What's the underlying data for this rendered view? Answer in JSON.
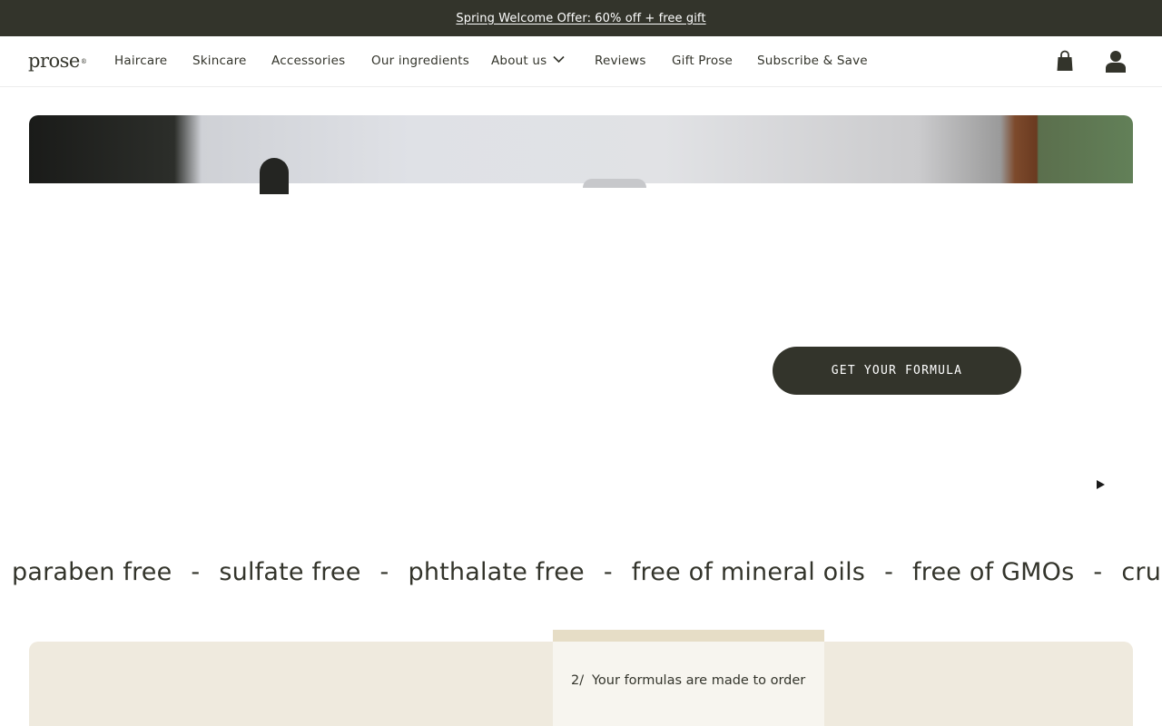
{
  "promo": {
    "text": "Spring Welcome Offer: 60% off + free gift"
  },
  "header": {
    "logo_text": "prose",
    "logo_mark": "®",
    "nav": [
      {
        "label": "Haircare"
      },
      {
        "label": "Skincare"
      },
      {
        "label": "Accessories"
      },
      {
        "label": "Our ingredients"
      },
      {
        "label": "About us",
        "icon": "chevron-down-icon"
      },
      {
        "label": "Reviews"
      },
      {
        "label": "Gift Prose"
      },
      {
        "label": "Subscribe & Save"
      }
    ],
    "icons": [
      "shopping-bag-icon",
      "account-icon"
    ]
  },
  "hero": {
    "cta_label": "GET YOUR FORMULA",
    "video_icon": "play-icon"
  },
  "marquee": {
    "items": [
      "paraben free",
      "sulfate free",
      "phthalate free",
      "free of mineral oils",
      "free of GMOs",
      "cruelty-free"
    ],
    "separator": "-"
  },
  "steps": {
    "current": {
      "number": "2/",
      "text": "Your formulas are made to order"
    }
  },
  "colors": {
    "dark": "#33342b",
    "panel_beige": "#efeade",
    "card_cream": "#f7f5ef",
    "card_accent": "#e6ddc6"
  }
}
